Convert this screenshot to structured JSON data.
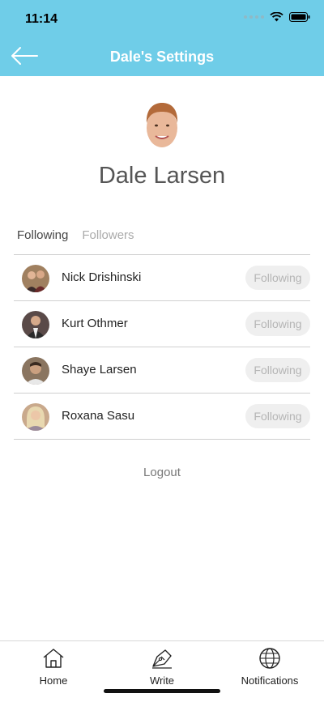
{
  "status_bar": {
    "time": "11:14"
  },
  "nav": {
    "title": "Dale's Settings",
    "back_icon": "arrow-left-icon"
  },
  "profile": {
    "name": "Dale Larsen"
  },
  "tabs": [
    {
      "label": "Following",
      "active": true
    },
    {
      "label": "Followers",
      "active": false
    }
  ],
  "following": [
    {
      "name": "Nick Drishinski",
      "button": "Following"
    },
    {
      "name": "Kurt Othmer",
      "button": "Following"
    },
    {
      "name": "Shaye Larsen",
      "button": "Following"
    },
    {
      "name": "Roxana Sasu",
      "button": "Following"
    }
  ],
  "logout_label": "Logout",
  "tabbar": {
    "home_label": "Home",
    "write_label": "Write",
    "notifications_label": "Notifications"
  },
  "colors": {
    "header": "#6fcde8",
    "button_bg": "#efefef",
    "button_text": "#b5b5b5"
  }
}
